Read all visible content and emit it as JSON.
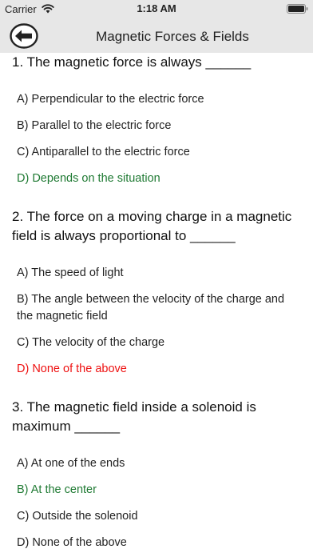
{
  "status_bar": {
    "carrier": "Carrier",
    "time": "1:18 AM",
    "icons": [
      "wifi-icon",
      "battery-icon"
    ]
  },
  "nav": {
    "title": "Magnetic Forces & Fields",
    "back_icon": "back-arrow-icon"
  },
  "colors": {
    "bar_background": "#e7e7e7",
    "correct": "#1f7a33",
    "wrong": "#ee1111",
    "text": "#222222"
  },
  "questions": [
    {
      "text": "1. The magnetic force is always ______",
      "options": [
        {
          "label": "A) Perpendicular to the electric force",
          "state": "normal"
        },
        {
          "label": "B) Parallel to the electric force",
          "state": "normal"
        },
        {
          "label": "C) Antiparallel to the electric force",
          "state": "normal"
        },
        {
          "label": "D) Depends on the situation",
          "state": "correct"
        }
      ]
    },
    {
      "text": "2. The force on a moving charge in a magnetic field is always proportional to ______",
      "options": [
        {
          "label": "A) The speed of light",
          "state": "normal"
        },
        {
          "label": "B) The angle between the velocity of the charge and the magnetic field",
          "state": "normal"
        },
        {
          "label": "C) The velocity of the charge",
          "state": "normal"
        },
        {
          "label": "D) None of the above",
          "state": "wrong"
        }
      ]
    },
    {
      "text": "3. The magnetic field inside a solenoid is maximum ______",
      "options": [
        {
          "label": "A) At one of the ends",
          "state": "normal"
        },
        {
          "label": "B) At the center",
          "state": "correct"
        },
        {
          "label": "C) Outside the solenoid",
          "state": "normal"
        },
        {
          "label": "D) None of the above",
          "state": "normal"
        }
      ]
    }
  ]
}
